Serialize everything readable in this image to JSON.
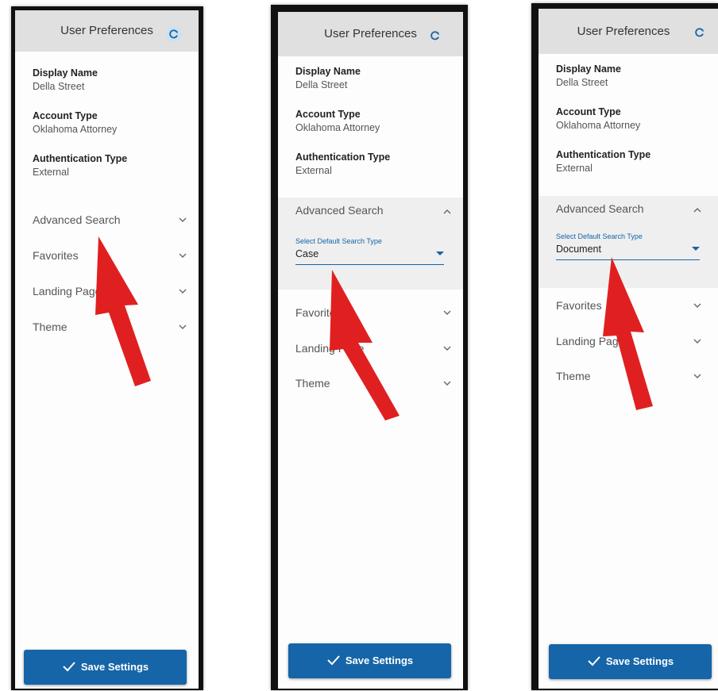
{
  "panels": [
    {
      "header_title": "User Preferences",
      "display_name_label": "Display Name",
      "display_name_value": "Della Street",
      "account_type_label": "Account Type",
      "account_type_value": "Oklahoma Attorney",
      "auth_type_label": "Authentication Type",
      "auth_type_value": "External",
      "sections": [
        "Advanced Search",
        "Favorites",
        "Landing Page",
        "Theme"
      ],
      "save_label": "Save Settings"
    },
    {
      "header_title": "User Preferences",
      "display_name_label": "Display Name",
      "display_name_value": "Della Street",
      "account_type_label": "Account Type",
      "account_type_value": "Oklahoma Attorney",
      "auth_type_label": "Authentication Type",
      "auth_type_value": "External",
      "sections": [
        "Advanced Search",
        "Favorites",
        "Landing Page",
        "Theme"
      ],
      "select_label": "Select Default Search Type",
      "select_value": "Case",
      "save_label": "Save Settings"
    },
    {
      "header_title": "User Preferences",
      "display_name_label": "Display Name",
      "display_name_value": "Della Street",
      "account_type_label": "Account Type",
      "account_type_value": "Oklahoma Attorney",
      "auth_type_label": "Authentication Type",
      "auth_type_value": "External",
      "sections": [
        "Advanced Search",
        "Favorites",
        "Landing Page",
        "Theme"
      ],
      "select_label": "Select Default Search Type",
      "select_value": "Document",
      "save_label": "Save Settings"
    }
  ],
  "colors": {
    "accent": "#1565a8",
    "header_bg": "#e0e0e0",
    "expanded_bg": "#efefef",
    "annotation_arrow": "#e02020"
  },
  "icons": [
    "refresh-icon",
    "chevron-down-icon",
    "chevron-up-icon",
    "check-icon",
    "annotation-arrow"
  ]
}
